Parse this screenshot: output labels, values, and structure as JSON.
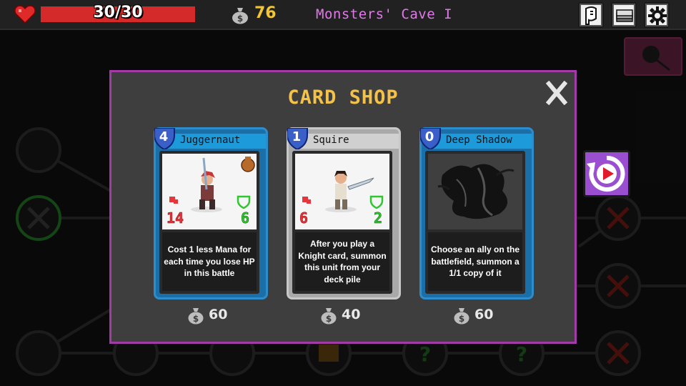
{
  "hud": {
    "hp_text": "30/30",
    "hp_fraction": 1.0,
    "gold": "76",
    "level_title": "Monsters' Cave I",
    "icons": [
      "heart-icon",
      "money-bag-icon",
      "map-scroll-icon",
      "card-deck-icon",
      "gear-icon"
    ]
  },
  "shop": {
    "title": "CARD SHOP",
    "close_icon": "close-x-icon",
    "reroll_icon": "refresh-play-icon",
    "cards": [
      {
        "name": "Juggernaut",
        "mana": "4",
        "attack": "14",
        "health": "6",
        "description": "Cost 1 less Mana for each time you lose HP in this battle",
        "price": "60",
        "frame": "blue",
        "art": "red-haired-warrior-with-sword"
      },
      {
        "name": "Squire",
        "mana": "1",
        "attack": "6",
        "health": "2",
        "description": "After you play a Knight card, summon this unit from your deck pile",
        "price": "40",
        "frame": "gray",
        "art": "squire-with-sword"
      },
      {
        "name": "Deep Shadow",
        "mana": "0",
        "attack": "",
        "health": "",
        "description": "Choose an ally on the battlefield, summon a 1/1 copy of it",
        "price": "60",
        "frame": "blue",
        "art": "dark-shadow-spell"
      }
    ]
  },
  "colors": {
    "modal_border": "#a43aa8",
    "title": "#f3c24a",
    "gold": "#f2c532",
    "level_title": "#e07ae8",
    "hp": "#d42a2a"
  }
}
